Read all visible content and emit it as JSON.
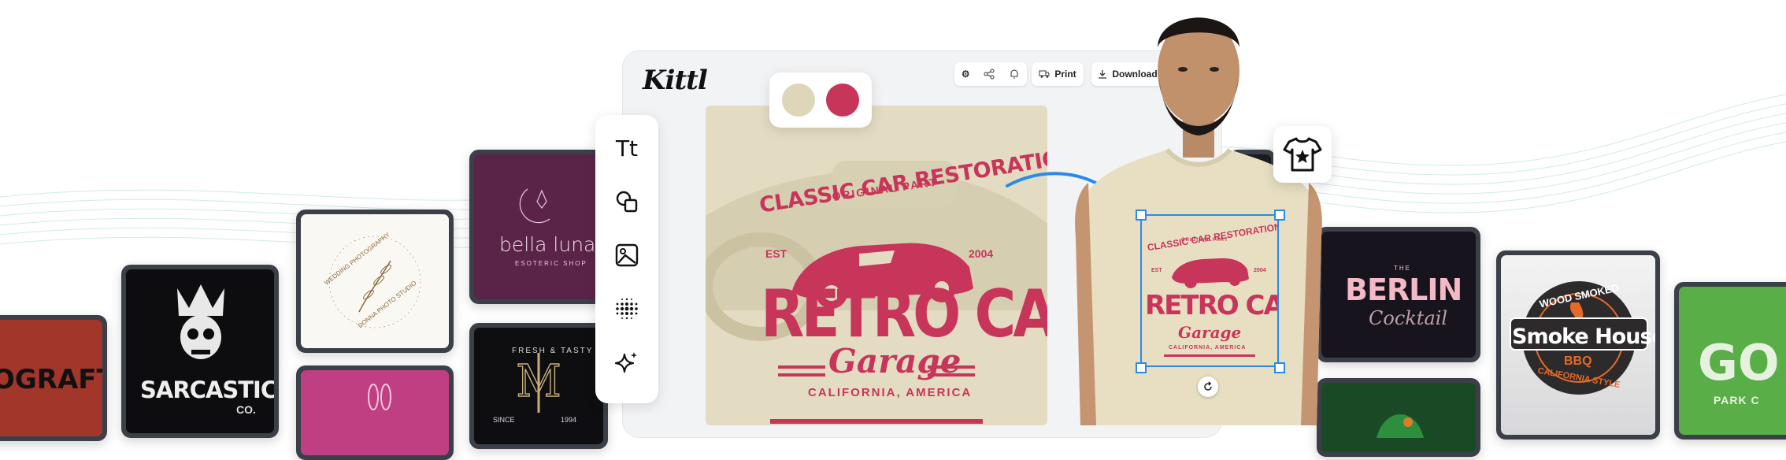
{
  "app": {
    "brand": "Kittl",
    "toolbar": {
      "print_label": "Print",
      "download_label": "Download"
    },
    "colors": {
      "accent": "#c8355a",
      "cream": "#e3dcc2",
      "selection": "#2a8be6"
    },
    "palette": [
      "#ddd6b8",
      "#c8355a"
    ],
    "tools": [
      "text-tool-icon",
      "shapes-tool-icon",
      "image-tool-icon",
      "halftone-tool-icon",
      "ai-sparkle-tool-icon"
    ],
    "text_tool_glyph": "Tt"
  },
  "design": {
    "arc_top": "CLASSIC CAR RESTORATION",
    "sub_arc": "ORIGINAL PART",
    "est_label": "EST",
    "year": "2004",
    "headline": "RETRO CAR",
    "script": "Garage",
    "location": "CALIFORNIA, AMERICA"
  },
  "gallery": [
    {
      "id": "grafted",
      "text": "OGRAFT"
    },
    {
      "id": "sarcastic",
      "text": "SARCASTIC",
      "sub": "CO."
    },
    {
      "id": "wedding",
      "arc1": "WEDDING PHOTOGRAPHY",
      "arc2": "DONNA PHOTO STUDIO"
    },
    {
      "id": "bella",
      "title": "bella luna",
      "sub": "ESOTERIC SHOP"
    },
    {
      "id": "monogram",
      "arc1": "FRESH & TASTY",
      "since": "SINCE",
      "year": "1994"
    },
    {
      "id": "berlin",
      "the": "THE",
      "title": "BERLIN",
      "script": "Cocktail"
    },
    {
      "id": "smokehouse",
      "arc1": "WOOD SMOKED",
      "title": "Smoke House",
      "badge": "BBQ",
      "arc2": "CALIFORNIA STYLE"
    },
    {
      "id": "park",
      "letters": "GO",
      "sub": "PARK C"
    }
  ]
}
